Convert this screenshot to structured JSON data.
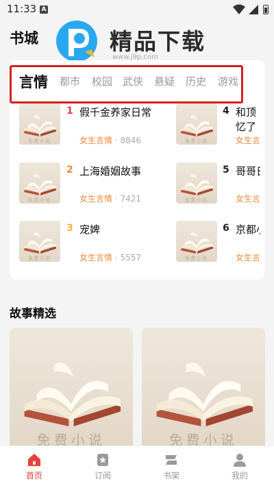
{
  "status_bar": {
    "time": "11:33",
    "sim_badge": "A"
  },
  "page_title": "书城",
  "watermark": {
    "text": "精品下载",
    "url": "www.j9p.com"
  },
  "tabs": [
    {
      "label": "言情",
      "active": true
    },
    {
      "label": "都市"
    },
    {
      "label": "校园"
    },
    {
      "label": "武侠"
    },
    {
      "label": "悬疑"
    },
    {
      "label": "历史"
    },
    {
      "label": "游戏"
    }
  ],
  "books": [
    {
      "rank": "1",
      "title": "假千金养家日常",
      "category": "女生言情",
      "sep": "·",
      "count": "8846",
      "rank_color": "#e8413a"
    },
    {
      "rank": "2",
      "title": "上海婚姻故事",
      "category": "女生言情",
      "sep": "·",
      "count": "7421",
      "rank_color": "#f08a3e"
    },
    {
      "rank": "3",
      "title": "宠婢",
      "category": "女生言情",
      "sep": "·",
      "count": "5557",
      "rank_color": "#f5b53d"
    },
    {
      "rank": "4",
      "title": "和顶",
      "title_line2": "忆了",
      "category": "女生言",
      "rank_color": "#222"
    },
    {
      "rank": "5",
      "title": "哥哥日",
      "category": "女生言",
      "rank_color": "#222"
    },
    {
      "rank": "6",
      "title": "京都小",
      "category": "女生言",
      "rank_color": "#222"
    }
  ],
  "cover_caption": "免费小说",
  "section_title": "故事精选",
  "bottom_nav": [
    {
      "label": "首页",
      "icon": "home-icon",
      "active": true
    },
    {
      "label": "订阅",
      "icon": "bookmark-icon"
    },
    {
      "label": "书架",
      "icon": "bookshelf-icon"
    },
    {
      "label": "我的",
      "icon": "profile-icon"
    }
  ],
  "colors": {
    "accent": "#e8413a",
    "category": "#f08a3e",
    "highlight_box": "#d42020"
  }
}
